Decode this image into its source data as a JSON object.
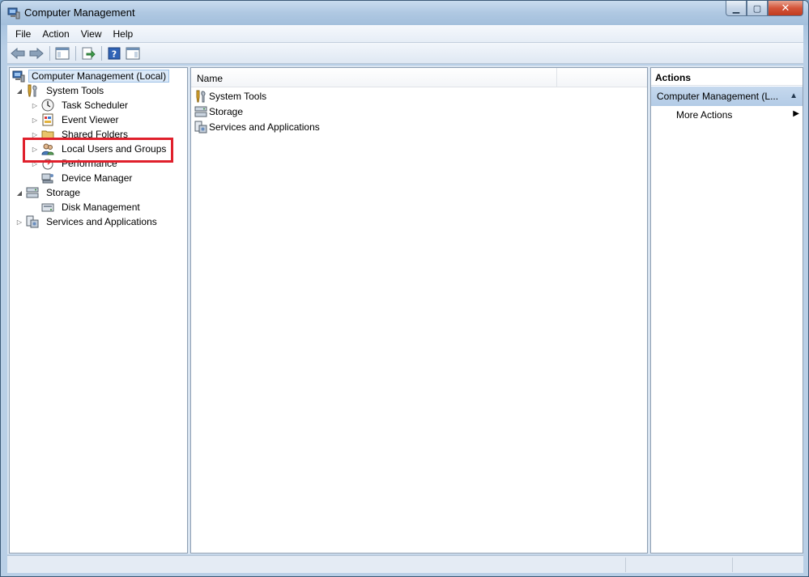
{
  "window": {
    "title": "Computer Management"
  },
  "menu": [
    "File",
    "Action",
    "View",
    "Help"
  ],
  "tree": [
    {
      "label": "Computer Management (Local)",
      "icon": "computer-management-icon",
      "selected": true,
      "arrow": ""
    },
    {
      "label": "System Tools",
      "icon": "system-tools-icon",
      "arrow": "expanded"
    },
    {
      "label": "Task Scheduler",
      "icon": "clock-icon",
      "arrow": "collapsed"
    },
    {
      "label": "Event Viewer",
      "icon": "event-viewer-icon",
      "arrow": "collapsed"
    },
    {
      "label": "Shared Folders",
      "icon": "shared-folder-icon",
      "arrow": "collapsed"
    },
    {
      "label": "Local Users and Groups",
      "icon": "users-icon",
      "arrow": "collapsed"
    },
    {
      "label": "Performance",
      "icon": "performance-icon",
      "arrow": "collapsed"
    },
    {
      "label": "Device Manager",
      "icon": "device-manager-icon",
      "arrow": ""
    },
    {
      "label": "Storage",
      "icon": "storage-icon",
      "arrow": "expanded"
    },
    {
      "label": "Disk Management",
      "icon": "disk-icon",
      "arrow": ""
    },
    {
      "label": "Services and Applications",
      "icon": "services-icon",
      "arrow": "collapsed"
    }
  ],
  "list": {
    "column_name": "Name",
    "items": [
      "System Tools",
      "Storage",
      "Services and Applications"
    ]
  },
  "actions": {
    "header": "Actions",
    "group": "Computer Management (L...",
    "more": "More Actions"
  }
}
